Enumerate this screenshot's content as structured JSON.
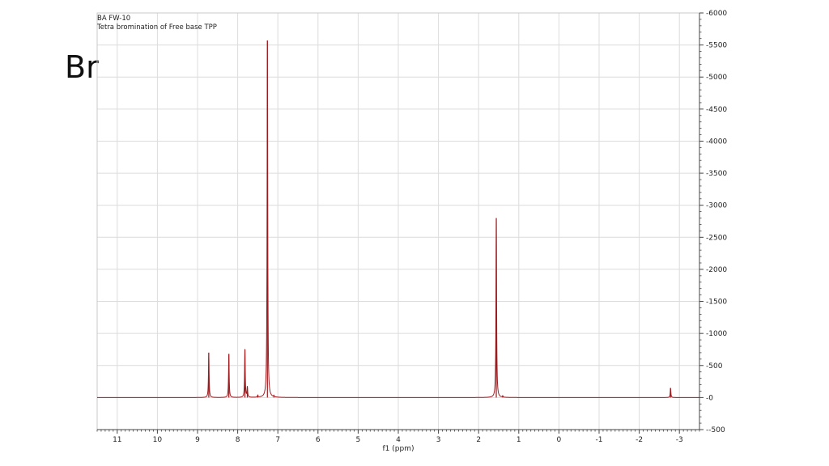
{
  "slide": {
    "title": "Br"
  },
  "chart_data": {
    "type": "line",
    "header_lines": [
      "BA FW-10",
      "Tetra bromination of Free base TPP"
    ],
    "xlabel": "f1 (ppm)",
    "ylabel": "",
    "xlim": [
      11.5,
      -3.5
    ],
    "ylim": [
      -500,
      6000
    ],
    "x_reversed": true,
    "x_ticks": [
      11,
      10,
      9,
      8,
      7,
      6,
      5,
      4,
      3,
      2,
      1,
      0,
      -1,
      -2,
      -3
    ],
    "y_ticks": [
      6000,
      5500,
      5000,
      4500,
      4000,
      3500,
      3000,
      2500,
      2000,
      1500,
      1000,
      500,
      0,
      -500
    ],
    "y_axis_side": "right",
    "grid": true,
    "colors": {
      "spectrum": "#9b1b1f",
      "grid": "#dcdcdc",
      "axis": "#444444"
    },
    "series": [
      {
        "peaks": [
          {
            "x": 8.72,
            "y": 700
          },
          {
            "x": 8.22,
            "y": 680
          },
          {
            "x": 7.82,
            "y": 750
          },
          {
            "x": 7.76,
            "y": 160
          },
          {
            "x": 7.5,
            "y": 30
          },
          {
            "x": 7.26,
            "y": 5570
          },
          {
            "x": 7.1,
            "y": 20
          },
          {
            "x": 1.56,
            "y": 2800
          },
          {
            "x": 1.4,
            "y": 20
          },
          {
            "x": -2.78,
            "y": 150
          }
        ]
      }
    ]
  }
}
